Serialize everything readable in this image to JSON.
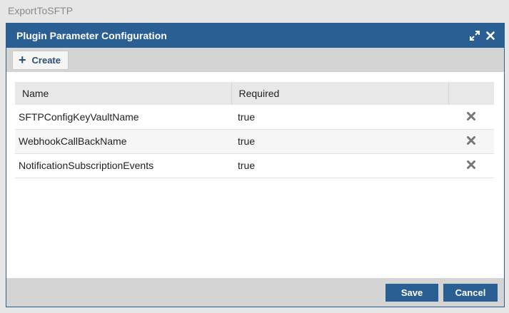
{
  "background": {
    "title": "ExportToSFTP"
  },
  "dialog": {
    "title": "Plugin Parameter Configuration",
    "controls": {
      "maximize_icon": "expand-arrows",
      "close_icon": "close-x"
    }
  },
  "toolbar": {
    "create_label": "Create",
    "create_icon": "plus"
  },
  "table": {
    "headers": {
      "name": "Name",
      "required": "Required",
      "actions": ""
    },
    "rows": [
      {
        "name": "SFTPConfigKeyVaultName",
        "required": "true"
      },
      {
        "name": "WebhookCallBackName",
        "required": "true"
      },
      {
        "name": "NotificationSubscriptionEvents",
        "required": "true"
      }
    ]
  },
  "footer": {
    "save_label": "Save",
    "cancel_label": "Cancel"
  },
  "colors": {
    "primary": "#2a5f93",
    "toolbar": "#d4d4d4",
    "delete_icon": "#777777"
  }
}
